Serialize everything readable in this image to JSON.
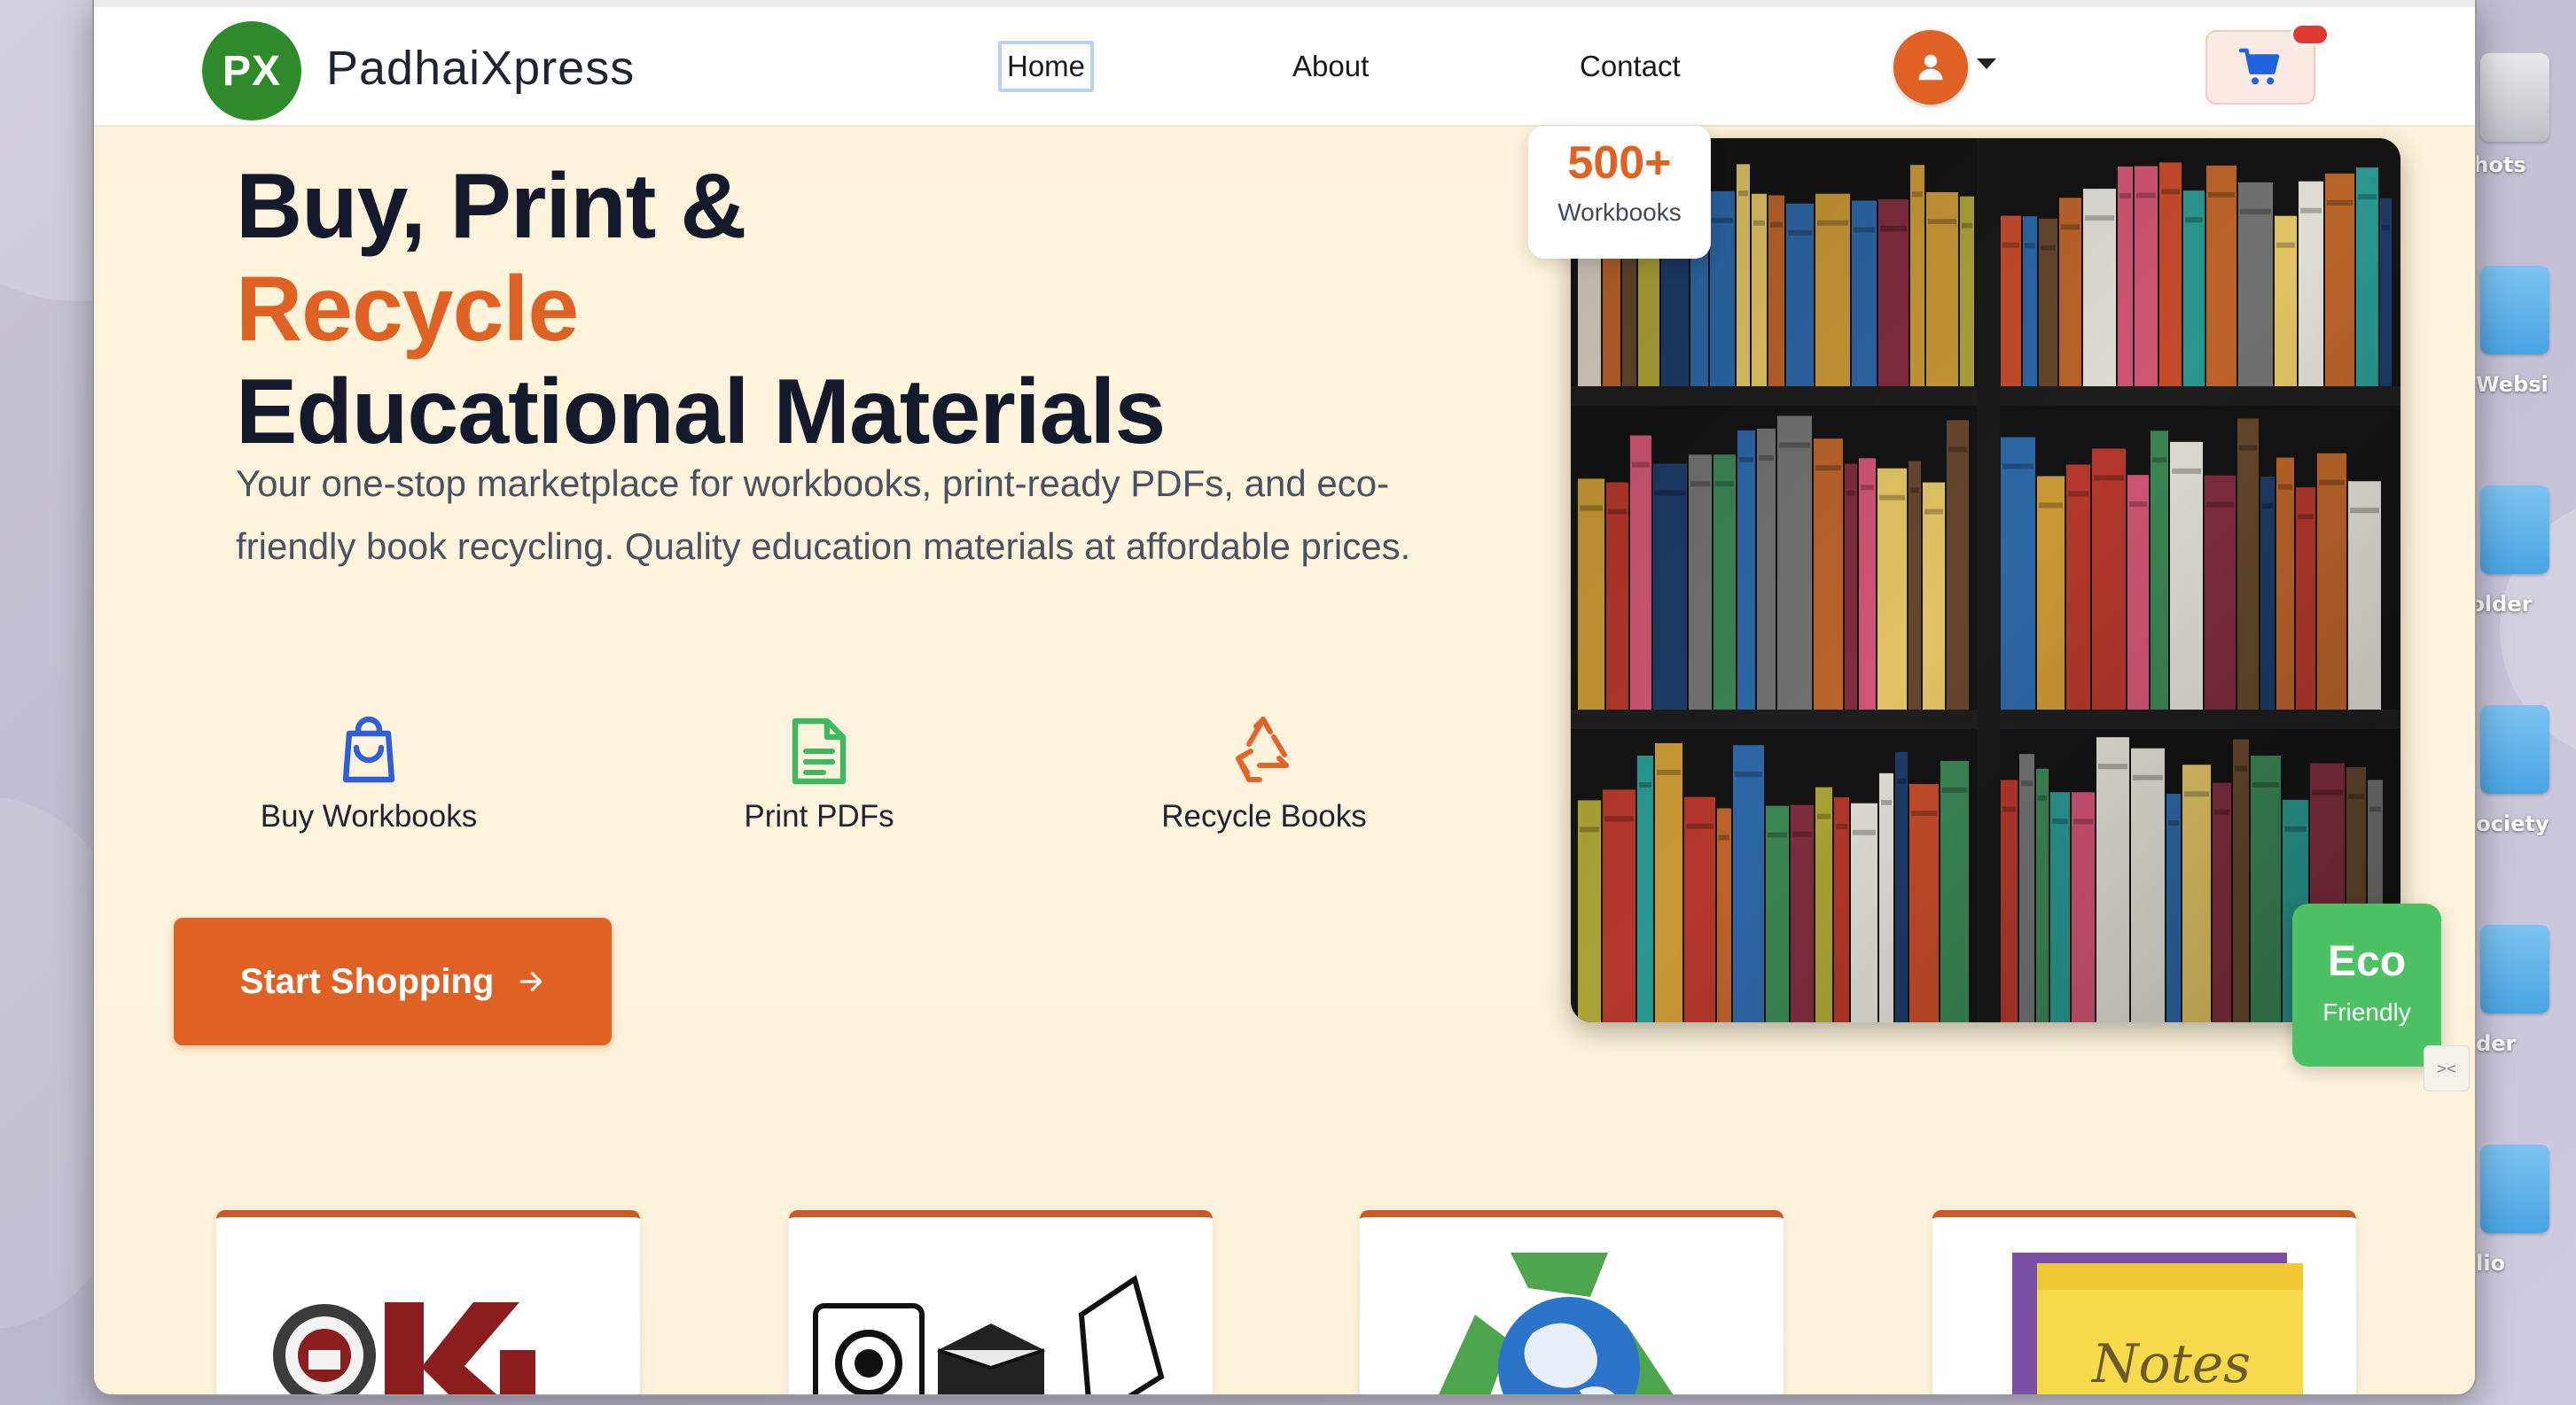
{
  "desktop": {
    "icons": [
      {
        "label": "shots"
      },
      {
        "label": "gWebsi"
      },
      {
        "label": "folder"
      },
      {
        "label": "Society"
      },
      {
        "label": "nder"
      },
      {
        "label": "plio"
      }
    ]
  },
  "brand": {
    "logo_text": "PX",
    "name": "PadhaiXpress",
    "accent_color": "#df6224",
    "logo_color": "#2f8a2c"
  },
  "nav": {
    "links": [
      {
        "label": "Home",
        "active": true
      },
      {
        "label": "About"
      },
      {
        "label": "Contact"
      }
    ],
    "avatar_icon": "user-icon",
    "cart_icon": "cart-icon"
  },
  "hero": {
    "title_line1": "Buy, Print &",
    "title_accent": "Recycle",
    "title_line3": "Educational Materials",
    "description": "Your one-stop marketplace for workbooks, print-ready PDFs, and eco-friendly book recycling. Quality education materials at affordable prices.",
    "features": [
      {
        "label": "Buy Workbooks",
        "icon": "shopping-bag-icon",
        "color": "#2f5fd6"
      },
      {
        "label": "Print PDFs",
        "icon": "document-icon",
        "color": "#3fb861"
      },
      {
        "label": "Recycle Books",
        "icon": "recycle-icon",
        "color": "#e0672b"
      }
    ],
    "cta_label": "Start Shopping",
    "cta_icon": "arrow-right-icon"
  },
  "stats": {
    "value": "500+",
    "label": "Workbooks"
  },
  "eco_badge": {
    "title": "Eco",
    "subtitle": "Friendly",
    "color": "#4cc265"
  },
  "categories": [
    {
      "image": "university-logo-kl"
    },
    {
      "image": "printer-camera-illustration"
    },
    {
      "image": "recycle-globe"
    },
    {
      "image": "notes-sticky"
    }
  ]
}
